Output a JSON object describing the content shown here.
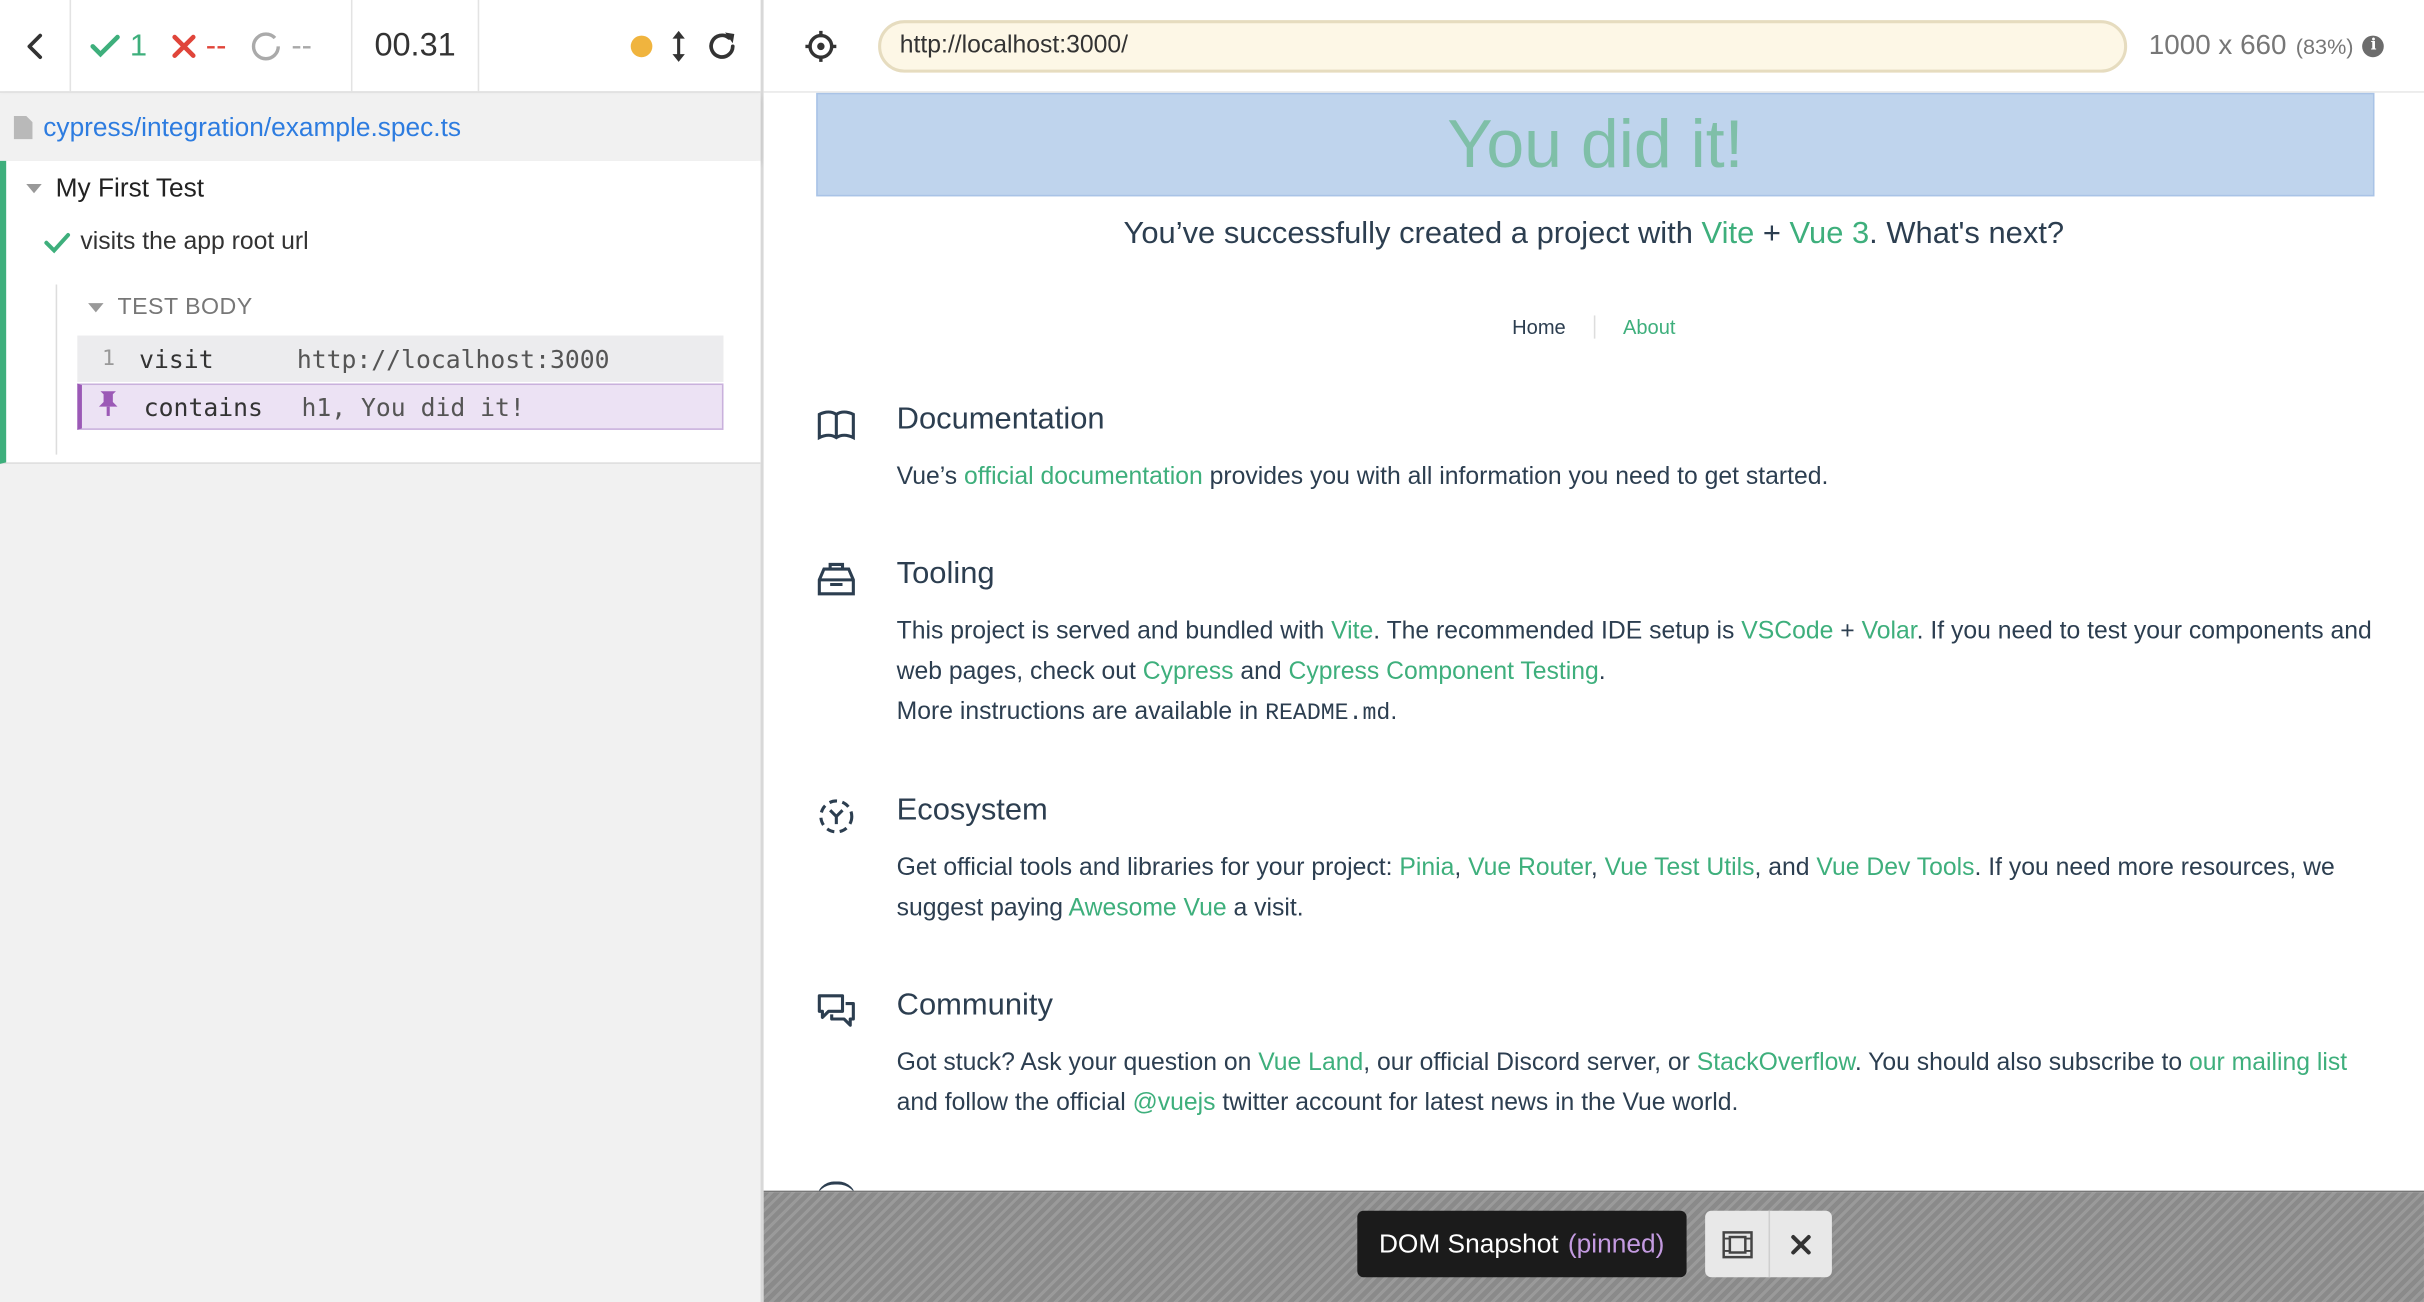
{
  "runner": {
    "stats": {
      "passed": "1",
      "failed": "--",
      "pending": "--"
    },
    "duration": "00.31",
    "spec_path": "cypress/integration/example.spec.ts",
    "suite_title": "My First Test",
    "test_title": "visits the app root url",
    "test_body_label": "TEST BODY",
    "commands": [
      {
        "number": "1",
        "name": "visit",
        "message": "http://localhost:3000"
      },
      {
        "number": "",
        "name": "contains",
        "message": "h1, You did it!"
      }
    ],
    "status_color": "#3eaf7c"
  },
  "browser": {
    "url": "http://localhost:3000/",
    "viewport": "1000 x 660",
    "scale": "(83%)"
  },
  "app": {
    "hero_title": "You did it!",
    "greeting": {
      "before": "You’ve successfully created a project with ",
      "vite": "Vite",
      "plus": " + ",
      "vue": "Vue 3",
      "after": ". What's next?"
    },
    "nav": {
      "home": "Home",
      "about": "About"
    },
    "sections": {
      "documentation": {
        "title": "Documentation",
        "t1": "Vue’s ",
        "l1": "official documentation",
        "t2": " provides you with all information you need to get started."
      },
      "tooling": {
        "title": "Tooling",
        "t1": "This project is served and bundled with ",
        "l1": "Vite",
        "t2": ". The recommended IDE setup is ",
        "l2": "VSCode",
        "t3": " + ",
        "l3": "Volar",
        "t4": ". If you need to test your components and web pages, check out ",
        "l4": "Cypress",
        "t5": " and ",
        "l5": "Cypress Component Testing",
        "t6": ".",
        "t7": "More instructions are available in ",
        "code": "README.md",
        "t8": "."
      },
      "ecosystem": {
        "title": "Ecosystem",
        "t1": "Get official tools and libraries for your project: ",
        "l1": "Pinia",
        "t2": ", ",
        "l2": "Vue Router",
        "t3": ", ",
        "l3": "Vue Test Utils",
        "t4": ", and ",
        "l4": "Vue Dev Tools",
        "t5": ". If you need more resources, we suggest paying ",
        "l5": "Awesome Vue",
        "t6": " a visit."
      },
      "community": {
        "title": "Community",
        "t1": "Got stuck? Ask your question on ",
        "l1": "Vue Land",
        "t2": ", our official Discord server, or ",
        "l2": "StackOverflow",
        "t3": ". You should also subscribe to ",
        "l3": "our mailing list",
        "t4": " and follow the official ",
        "l4": "@vuejs",
        "t5": " twitter account for latest news in the Vue world."
      }
    },
    "accent_color": "#3eaf7c"
  },
  "snapshot": {
    "label": "DOM Snapshot",
    "pinned": "(pinned)"
  }
}
